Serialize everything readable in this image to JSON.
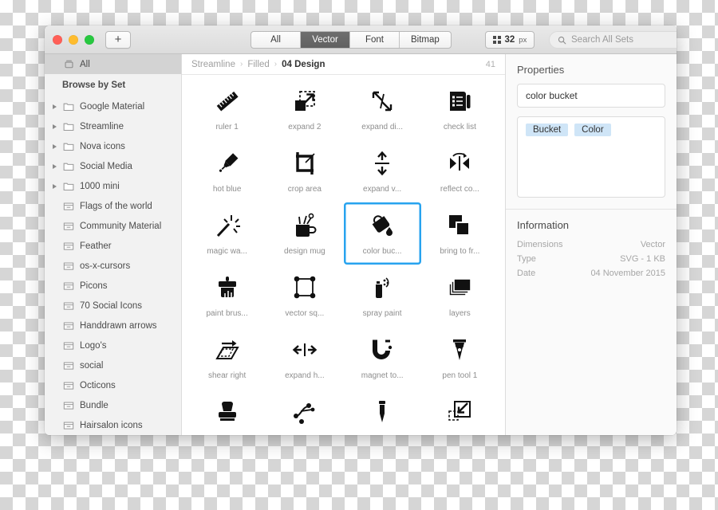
{
  "window": {
    "traffic_lights": [
      "close",
      "minimize",
      "zoom"
    ],
    "add_button_label": "+",
    "segments": [
      {
        "label": "All",
        "active": false
      },
      {
        "label": "Vector",
        "active": true
      },
      {
        "label": "Font",
        "active": false
      },
      {
        "label": "Bitmap",
        "active": false
      }
    ],
    "size_button": {
      "value": "32",
      "unit": "px",
      "icon": "grid-icon"
    },
    "search": {
      "placeholder": "Search All Sets",
      "value": "",
      "icon": "search-icon"
    }
  },
  "sidebar": {
    "all_item": {
      "label": "All",
      "icon": "library-icon",
      "selected": true
    },
    "section_header": "Browse by Set",
    "groups": [
      {
        "label": "Google Material",
        "icon": "folder-icon",
        "expandable": true
      },
      {
        "label": "Streamline",
        "icon": "folder-icon",
        "expandable": true
      },
      {
        "label": "Nova icons",
        "icon": "folder-icon",
        "expandable": true
      },
      {
        "label": "Social Media",
        "icon": "folder-icon",
        "expandable": true
      },
      {
        "label": "1000 mini",
        "icon": "folder-icon",
        "expandable": true
      }
    ],
    "sets": [
      {
        "label": "Flags of the world",
        "icon": "set-icon"
      },
      {
        "label": "Community Material",
        "icon": "set-icon"
      },
      {
        "label": "Feather",
        "icon": "set-icon"
      },
      {
        "label": "os-x-cursors",
        "icon": "set-icon"
      },
      {
        "label": "Picons",
        "icon": "set-icon"
      },
      {
        "label": "70 Social Icons",
        "icon": "set-icon"
      },
      {
        "label": "Handdrawn arrows",
        "icon": "set-icon"
      },
      {
        "label": "Logo's",
        "icon": "set-icon"
      },
      {
        "label": "social",
        "icon": "set-icon"
      },
      {
        "label": "Octicons",
        "icon": "set-icon"
      },
      {
        "label": "Bundle",
        "icon": "set-icon"
      },
      {
        "label": "Hairsalon icons",
        "icon": "set-icon"
      }
    ]
  },
  "main": {
    "breadcrumb": [
      "Streamline",
      "Filled",
      "04 Design"
    ],
    "breadcrumb_separator": "›",
    "count": "41",
    "icons": [
      {
        "label": "ruler 1",
        "glyph": "ruler-icon",
        "selected": false
      },
      {
        "label": "expand 2",
        "glyph": "expand-2-icon",
        "selected": false
      },
      {
        "label": "expand di...",
        "glyph": "expand-diagonal-icon",
        "selected": false
      },
      {
        "label": "check list",
        "glyph": "check-list-icon",
        "selected": false
      },
      {
        "label": "hot blue",
        "glyph": "hot-blue-icon",
        "selected": false
      },
      {
        "label": "crop area",
        "glyph": "crop-area-icon",
        "selected": false
      },
      {
        "label": "expand v...",
        "glyph": "expand-vertical-icon",
        "selected": false
      },
      {
        "label": "reflect co...",
        "glyph": "reflect-icon",
        "selected": false
      },
      {
        "label": "magic wa...",
        "glyph": "magic-wand-icon",
        "selected": false
      },
      {
        "label": "design mug",
        "glyph": "design-mug-icon",
        "selected": false
      },
      {
        "label": "color buc...",
        "glyph": "color-bucket-icon",
        "selected": true
      },
      {
        "label": "bring to fr...",
        "glyph": "bring-to-front-icon",
        "selected": false
      },
      {
        "label": "paint brus...",
        "glyph": "paint-brush-icon",
        "selected": false
      },
      {
        "label": "vector sq...",
        "glyph": "vector-square-icon",
        "selected": false
      },
      {
        "label": "spray paint",
        "glyph": "spray-paint-icon",
        "selected": false
      },
      {
        "label": "layers",
        "glyph": "layers-icon",
        "selected": false
      },
      {
        "label": "shear right",
        "glyph": "shear-right-icon",
        "selected": false
      },
      {
        "label": "expand h...",
        "glyph": "expand-horizontal-icon",
        "selected": false
      },
      {
        "label": "magnet to...",
        "glyph": "magnet-icon",
        "selected": false
      },
      {
        "label": "pen tool 1",
        "glyph": "pen-tool-icon",
        "selected": false
      },
      {
        "label": "",
        "glyph": "stamp-icon",
        "selected": false
      },
      {
        "label": "",
        "glyph": "bezier-icon",
        "selected": false
      },
      {
        "label": "",
        "glyph": "eyedropper-icon",
        "selected": false
      },
      {
        "label": "",
        "glyph": "collapse-icon",
        "selected": false
      }
    ]
  },
  "properties": {
    "title": "Properties",
    "name_value": "color bucket",
    "tags": [
      "Bucket",
      "Color"
    ]
  },
  "information": {
    "title": "Information",
    "rows": [
      {
        "key": "Dimensions",
        "value": "Vector"
      },
      {
        "key": "Type",
        "value": "SVG - 1 KB"
      },
      {
        "key": "Date",
        "value": "04 November 2015"
      }
    ]
  },
  "colors": {
    "selection_blue": "#27a3ef",
    "tag_blue": "#cfe5f7",
    "sidebar_bg": "#f2f2f2",
    "active_segment": "#686868"
  }
}
